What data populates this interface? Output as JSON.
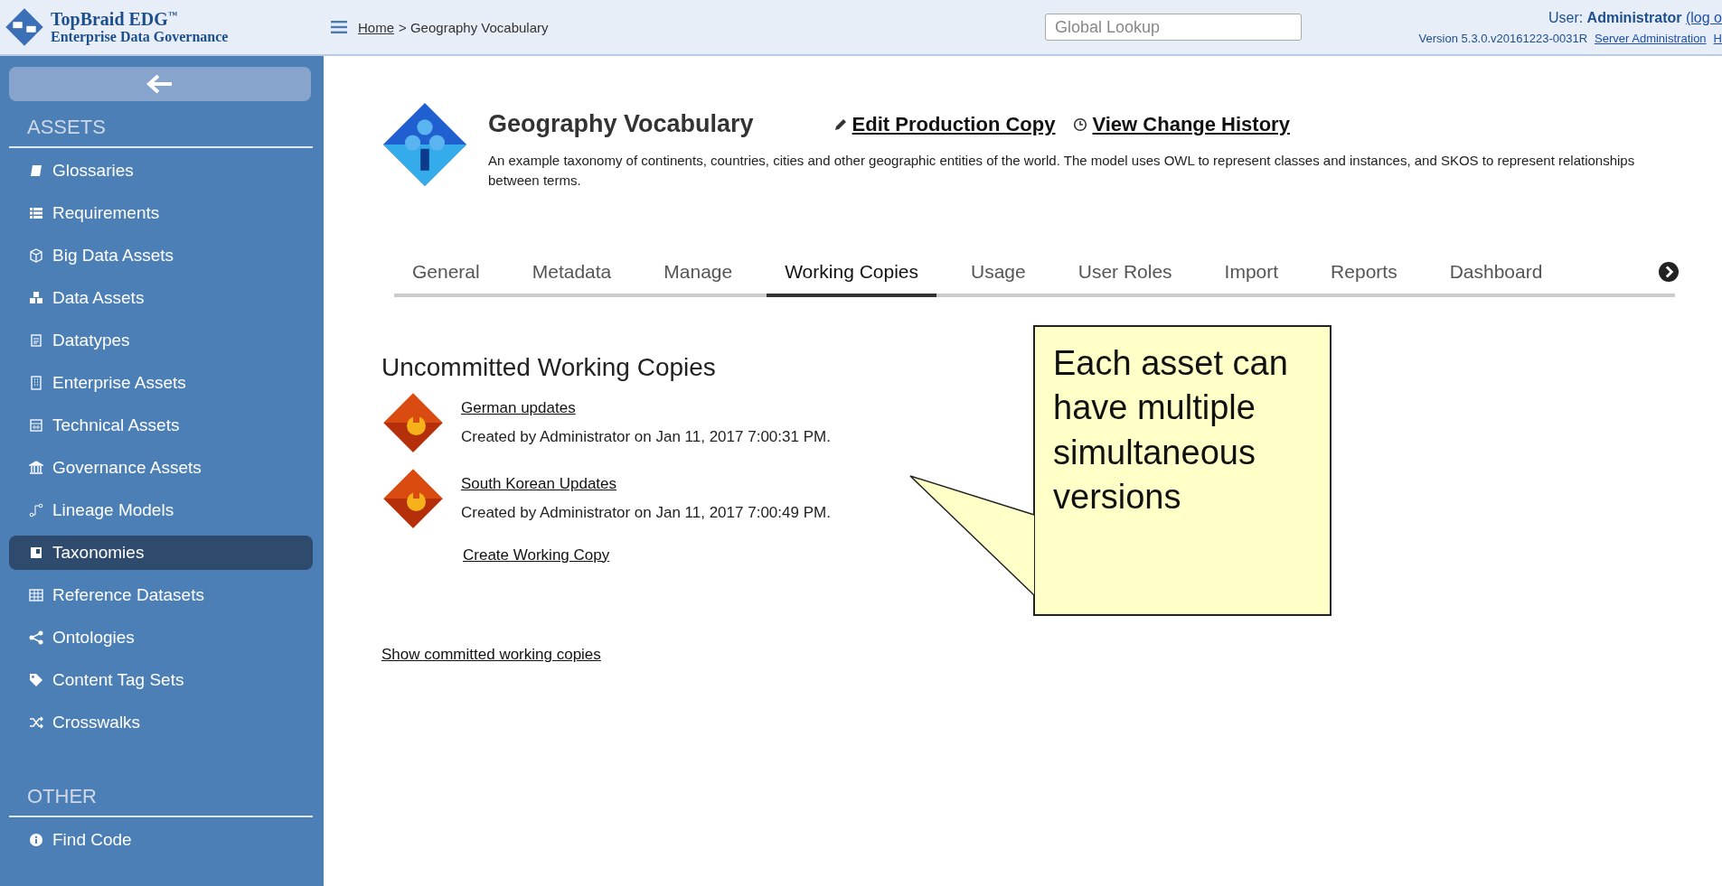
{
  "header": {
    "brand_name": "TopBraid EDG",
    "brand_tm": "™",
    "brand_subtitle": "Enterprise Data Governance",
    "breadcrumb_home": "Home",
    "breadcrumb_current": "> Geography Vocabulary",
    "search": {
      "placeholder": "Global Lookup"
    },
    "user_label": "User:",
    "user_name": "Administrator",
    "logout": "(log o",
    "version": "Version 5.3.0.v20161223-0031R",
    "admin_link": "Server Administration",
    "help_link": "H"
  },
  "sidebar": {
    "sections": [
      {
        "title": "ASSETS",
        "items": [
          {
            "label": "Glossaries",
            "kind": "book",
            "selected": false
          },
          {
            "label": "Requirements",
            "kind": "list",
            "selected": false
          },
          {
            "label": "Big Data Assets",
            "kind": "cube",
            "selected": false
          },
          {
            "label": "Data Assets",
            "kind": "cubes",
            "selected": false
          },
          {
            "label": "Datatypes",
            "kind": "doc",
            "selected": false
          },
          {
            "label": "Enterprise Assets",
            "kind": "building",
            "selected": false
          },
          {
            "label": "Technical Assets",
            "kind": "calc",
            "selected": false
          },
          {
            "label": "Governance Assets",
            "kind": "bank",
            "selected": false
          },
          {
            "label": "Lineage Models",
            "kind": "lineage",
            "selected": false
          },
          {
            "label": "Taxonomies",
            "kind": "board",
            "selected": true
          },
          {
            "label": "Reference Datasets",
            "kind": "table",
            "selected": false
          },
          {
            "label": "Ontologies",
            "kind": "share",
            "selected": false
          },
          {
            "label": "Content Tag Sets",
            "kind": "tag",
            "selected": false
          },
          {
            "label": "Crosswalks",
            "kind": "shuffle",
            "selected": false
          }
        ]
      },
      {
        "title": "OTHER",
        "items": [
          {
            "label": "Find Code",
            "kind": "info",
            "selected": false
          }
        ]
      }
    ]
  },
  "asset": {
    "title": "Geography Vocabulary",
    "actions": [
      {
        "label": "Edit Production Copy",
        "kind": "pencil"
      },
      {
        "label": "View Change History",
        "kind": "clock"
      }
    ],
    "description": "An example taxonomy of continents, countries, cities and other geographic entities of the world. The model uses OWL to represent classes and instances, and SKOS to represent relationships between terms."
  },
  "tabs": [
    {
      "label": "General",
      "selected": false
    },
    {
      "label": "Metadata",
      "selected": false
    },
    {
      "label": "Manage",
      "selected": false
    },
    {
      "label": "Working Copies",
      "selected": true
    },
    {
      "label": "Usage",
      "selected": false
    },
    {
      "label": "User Roles",
      "selected": false
    },
    {
      "label": "Import",
      "selected": false
    },
    {
      "label": "Reports",
      "selected": false
    },
    {
      "label": "Dashboard",
      "selected": false
    }
  ],
  "working_copies": {
    "heading": "Uncommitted Working Copies",
    "items": [
      {
        "name": "German updates",
        "created": "Created by Administrator on Jan 11, 2017 7:00:31 PM."
      },
      {
        "name": "South Korean Updates",
        "created": "Created by Administrator on Jan 11, 2017 7:00:49 PM."
      }
    ],
    "create_link": "Create Working Copy",
    "show_committed_link": "Show committed working copies"
  },
  "callout": {
    "text": "Each asset can have multiple simultaneous versions"
  }
}
